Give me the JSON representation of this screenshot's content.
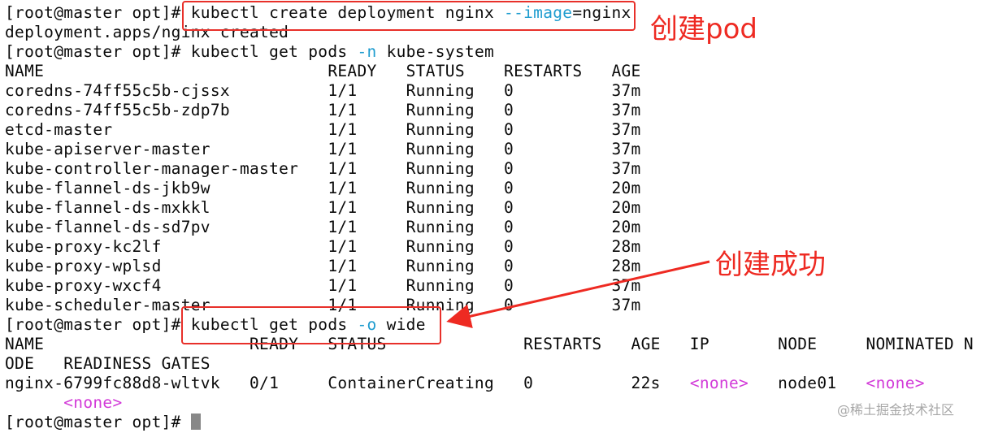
{
  "prompt": "[root@master opt]# ",
  "command1": {
    "pre": "kubectl create deployment nginx ",
    "opt": "--image",
    "post": "=nginx"
  },
  "output1": "deployment.apps/nginx created",
  "command2": {
    "pre": "kubectl get pods ",
    "opt": "-n",
    "post": " kube-system"
  },
  "pods_header": "NAME                             READY   STATUS    RESTARTS   AGE",
  "pods_rows": [
    "coredns-74ff55c5b-cjssx          1/1     Running   0          37m",
    "coredns-74ff55c5b-zdp7b          1/1     Running   0          37m",
    "etcd-master                      1/1     Running   0          37m",
    "kube-apiserver-master            1/1     Running   0          37m",
    "kube-controller-manager-master   1/1     Running   0          37m",
    "kube-flannel-ds-jkb9w            1/1     Running   0          20m",
    "kube-flannel-ds-mxkkl            1/1     Running   0          20m",
    "kube-flannel-ds-sd7pv            1/1     Running   0          20m",
    "kube-proxy-kc2lf                 1/1     Running   0          28m",
    "kube-proxy-wplsd                 1/1     Running   0          28m",
    "kube-proxy-wxcf4                 1/1     Running   0          37m",
    "kube-scheduler-master            1/1     Running   0          37m"
  ],
  "command3": {
    "pre": "kubectl get pods ",
    "opt": "-o",
    "post": " wide"
  },
  "wide_header": "NAME                     READY   STATUS              RESTARTS   AGE   IP       NODE     NOMINATED N",
  "wide_header_wrap": "ODE   READINESS GATES",
  "wide_row": {
    "main": "nginx-6799fc88d8-wltvk   0/1     ContainerCreating   0          22s   ",
    "ip": "<none>",
    "mid": "   node01   ",
    "nominated": "<none>",
    "wrap_indent": "      ",
    "readiness": "<none>"
  },
  "annotations": {
    "create_pod": "创建pod",
    "create_success": "创建成功"
  },
  "watermark": "@稀土掘金技术社区",
  "colors": {
    "option": "#1e9ccf",
    "none_value": "#d23ad8",
    "annotation": "#ee2a22",
    "text": "#0a0a0a"
  }
}
